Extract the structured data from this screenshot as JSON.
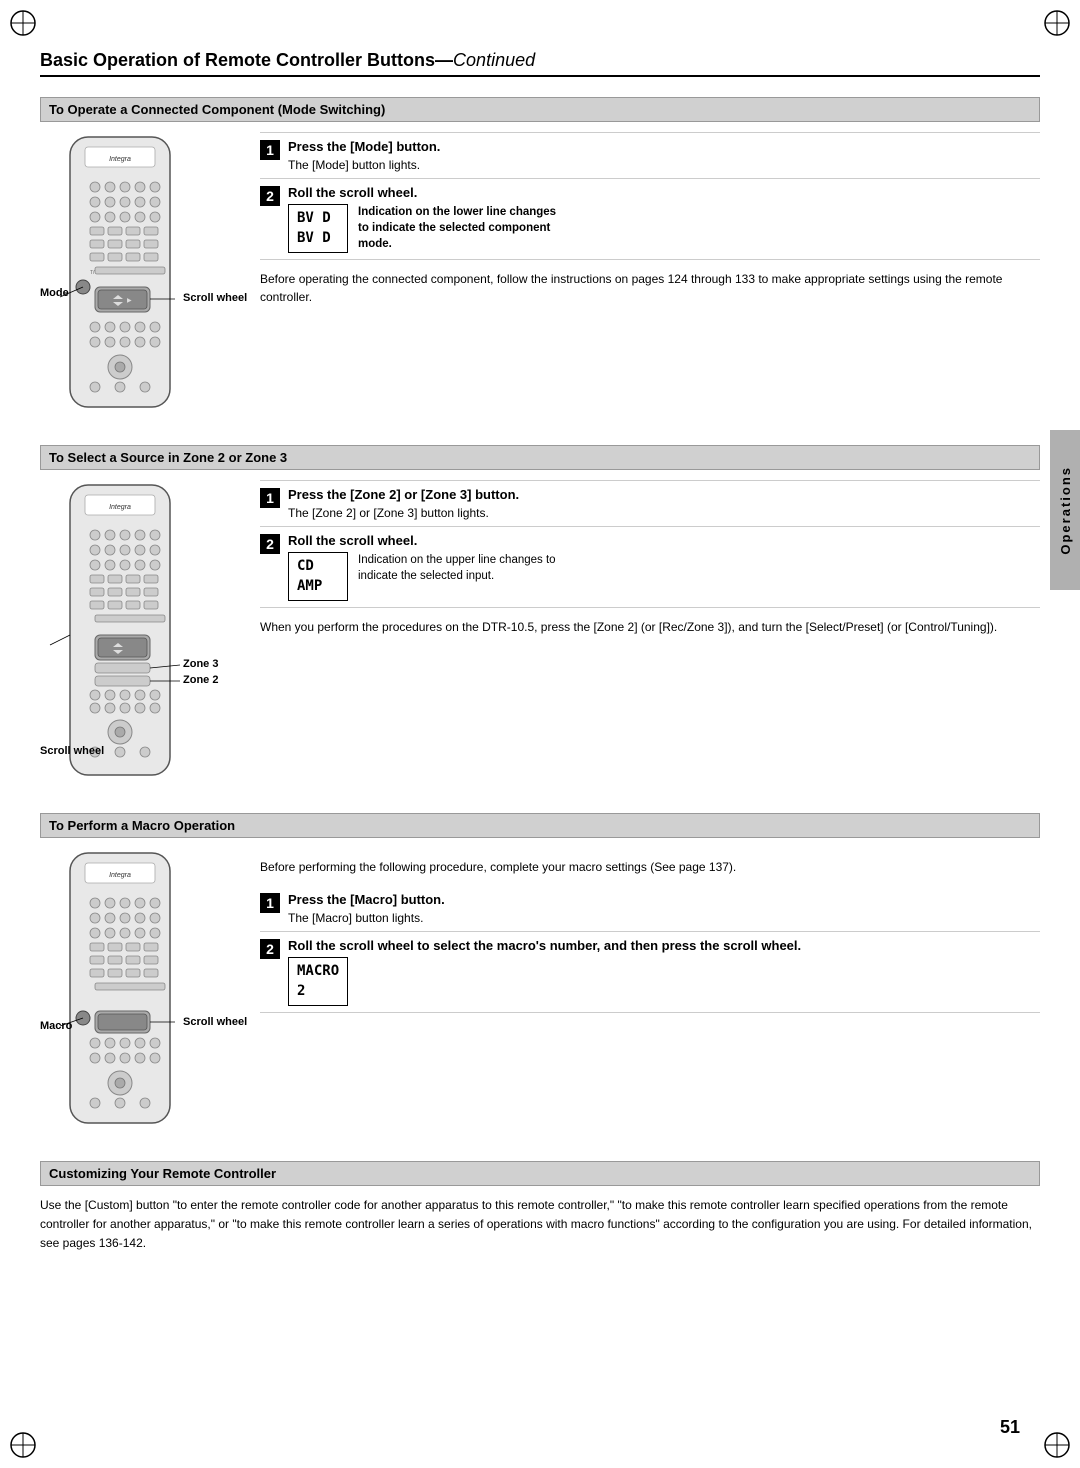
{
  "page": {
    "title": "Basic Operation of Remote Controller Buttons",
    "title_continued": "Continued",
    "page_number": "51",
    "sidebar_label": "Operations"
  },
  "section1": {
    "heading": "To Operate a Connected Component (Mode Switching)",
    "step1": {
      "num": "1",
      "title": "Press the [Mode] button.",
      "body": "The [Mode] button lights."
    },
    "step2": {
      "num": "2",
      "title": "Roll the scroll wheel.",
      "lcd_line1": "BV D",
      "lcd_line2": "BV D",
      "caption": "Indication on the lower line changes to indicate the selected component mode."
    },
    "note": "Before operating the connected component, follow the instructions on pages 124 through 133 to make appropriate settings using the remote controller.",
    "labels": {
      "mode": "Mode",
      "scroll_wheel": "Scroll wheel"
    }
  },
  "section2": {
    "heading": "To Select a Source in Zone 2 or Zone 3",
    "step1": {
      "num": "1",
      "title": "Press the [Zone 2] or [Zone 3] button.",
      "body": "The [Zone 2] or [Zone 3] button lights."
    },
    "step2": {
      "num": "2",
      "title": "Roll the scroll wheel.",
      "lcd_line1": "CD",
      "lcd_line2": "AMP",
      "caption": "Indication on the upper line changes to indicate the selected input."
    },
    "note": "When you perform the procedures on the DTR-10.5, press the [Zone 2] (or [Rec/Zone 3]), and turn the [Select/Preset] (or [Control/Tuning]).",
    "labels": {
      "zone3": "Zone 3",
      "zone2": "Zone 2",
      "scroll_wheel": "Scroll wheel"
    }
  },
  "section3": {
    "heading": "To Perform a Macro Operation",
    "pre_note": "Before performing the following procedure, complete your macro settings (See page 137).",
    "step1": {
      "num": "1",
      "title": "Press the [Macro] button.",
      "body": "The [Macro] button lights."
    },
    "step2": {
      "num": "2",
      "title": "Roll the scroll wheel to select the macro's number, and then press the scroll wheel.",
      "lcd_line1": "MACRO",
      "lcd_line2": "2"
    },
    "labels": {
      "macro": "Macro",
      "scroll_wheel": "Scroll wheel"
    }
  },
  "section4": {
    "heading": "Customizing Your Remote Controller",
    "body": "Use the [Custom] button \"to enter the remote controller code for another apparatus to this remote controller,\" \"to make this remote controller learn specified operations from the remote controller for another apparatus,\" or \"to make this remote controller learn a series of operations with macro functions\" according to the configuration you are using. For detailed information, see pages 136-142."
  }
}
